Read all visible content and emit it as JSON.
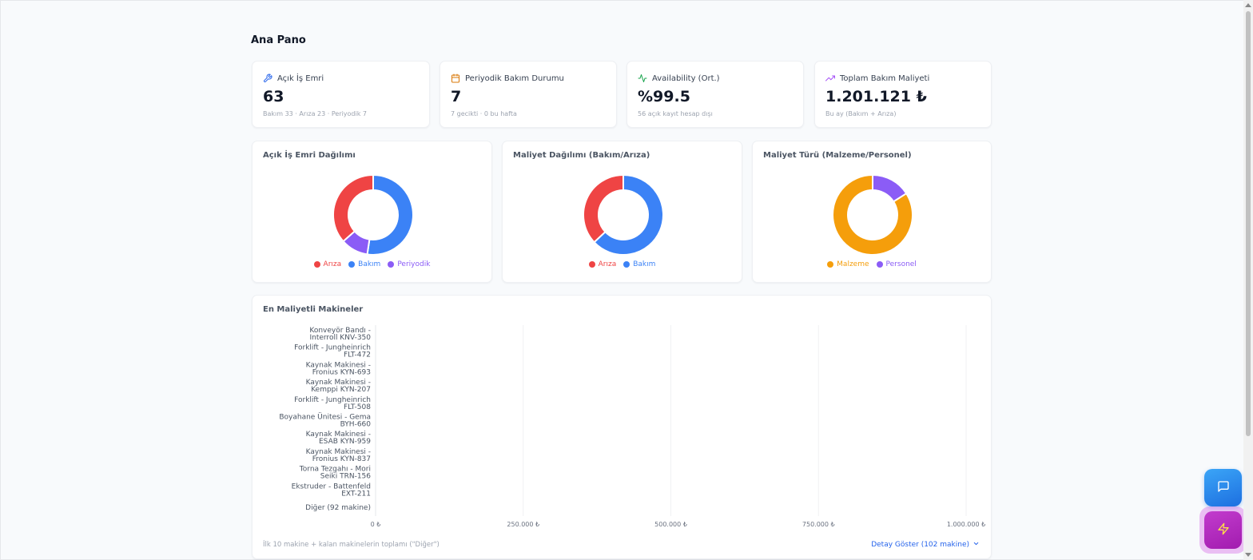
{
  "page": {
    "title": "Ana Pano"
  },
  "stats": [
    {
      "icon": "wrench-icon",
      "label": "Açık İş Emri",
      "value": "63",
      "sub": "Bakım 33 · Arıza 23 · Periyodik 7",
      "color": "#2563eb"
    },
    {
      "icon": "calendar-icon",
      "label": "Periyodik Bakım Durumu",
      "value": "7",
      "sub": "7 gecikti · 0 bu hafta",
      "color": "#d97706"
    },
    {
      "icon": "activity-icon",
      "label": "Availability (Ort.)",
      "value": "%99.5",
      "sub": "56 açık kayıt hesap dışı",
      "color": "#16a34a"
    },
    {
      "icon": "trending-up-icon",
      "label": "Toplam Bakım Maliyeti",
      "value": "1.201.121 ₺",
      "sub": "Bu ay (Bakım + Arıza)",
      "color": "#a855f7"
    }
  ],
  "donuts": [
    {
      "title": "Açık İş Emri Dağılımı",
      "slices": [
        {
          "label": "Bakım",
          "value": 33,
          "color": "#3b82f6"
        },
        {
          "label": "Periyodik",
          "value": 7,
          "color": "#8b5cf6"
        },
        {
          "label": "Arıza",
          "value": 23,
          "color": "#ef4444"
        }
      ],
      "legend": [
        {
          "label": "Arıza",
          "color": "#ef4444"
        },
        {
          "label": "Bakım",
          "color": "#3b82f6"
        },
        {
          "label": "Periyodik",
          "color": "#8b5cf6"
        }
      ]
    },
    {
      "title": "Maliyet Dağılımı (Bakım/Arıza)",
      "slices": [
        {
          "label": "Bakım",
          "value": 63,
          "color": "#3b82f6"
        },
        {
          "label": "Arıza",
          "value": 37,
          "color": "#ef4444"
        }
      ],
      "legend": [
        {
          "label": "Arıza",
          "color": "#ef4444"
        },
        {
          "label": "Bakım",
          "color": "#3b82f6"
        }
      ]
    },
    {
      "title": "Maliyet Türü (Malzeme/Personel)",
      "slices": [
        {
          "label": "Personel",
          "value": 16,
          "color": "#8b5cf6"
        },
        {
          "label": "Malzeme",
          "value": 84,
          "color": "#f59e0b"
        }
      ],
      "legend": [
        {
          "label": "Malzeme",
          "color": "#f59e0b"
        },
        {
          "label": "Personel",
          "color": "#8b5cf6"
        }
      ]
    }
  ],
  "chart_data": {
    "type": "bar",
    "title": "En Maliyetli Makineler",
    "orientation": "horizontal",
    "categories": [
      [
        "Konveyör Bandı -",
        "Interroll KNV-350"
      ],
      [
        "Forklift - Jungheinrich",
        "FLT-472"
      ],
      [
        "Kaynak Makinesi -",
        "Fronius KYN-693"
      ],
      [
        "Kaynak Makinesi -",
        "Kemppi KYN-207"
      ],
      [
        "Forklift - Jungheinrich",
        "FLT-508"
      ],
      [
        "Boyahane Ünitesi - Gema",
        "BYH-660"
      ],
      [
        "Kaynak Makinesi -",
        "ESAB KYN-959"
      ],
      [
        "Kaynak Makinesi -",
        "Fronius KYN-837"
      ],
      [
        "Torna Tezgahı - Mori",
        "Seiki TRN-156"
      ],
      [
        "Ekstruder - Battenfeld",
        "EXT-211"
      ],
      [
        "Diğer (92 makine)"
      ]
    ],
    "values": [
      0,
      0,
      0,
      0,
      0,
      0,
      0,
      0,
      0,
      0,
      0
    ],
    "xlim": [
      0,
      1000000
    ],
    "xticks": [
      "0 ₺",
      "250.000 ₺",
      "500.000 ₺",
      "750.000 ₺",
      "1.000.000 ₺"
    ],
    "grid": true
  },
  "bar_footer": {
    "note": "İlk 10 makine + kalan makinelerin toplamı (\"Diğer\")",
    "detail_label": "Detay Göster (102 makine)"
  }
}
